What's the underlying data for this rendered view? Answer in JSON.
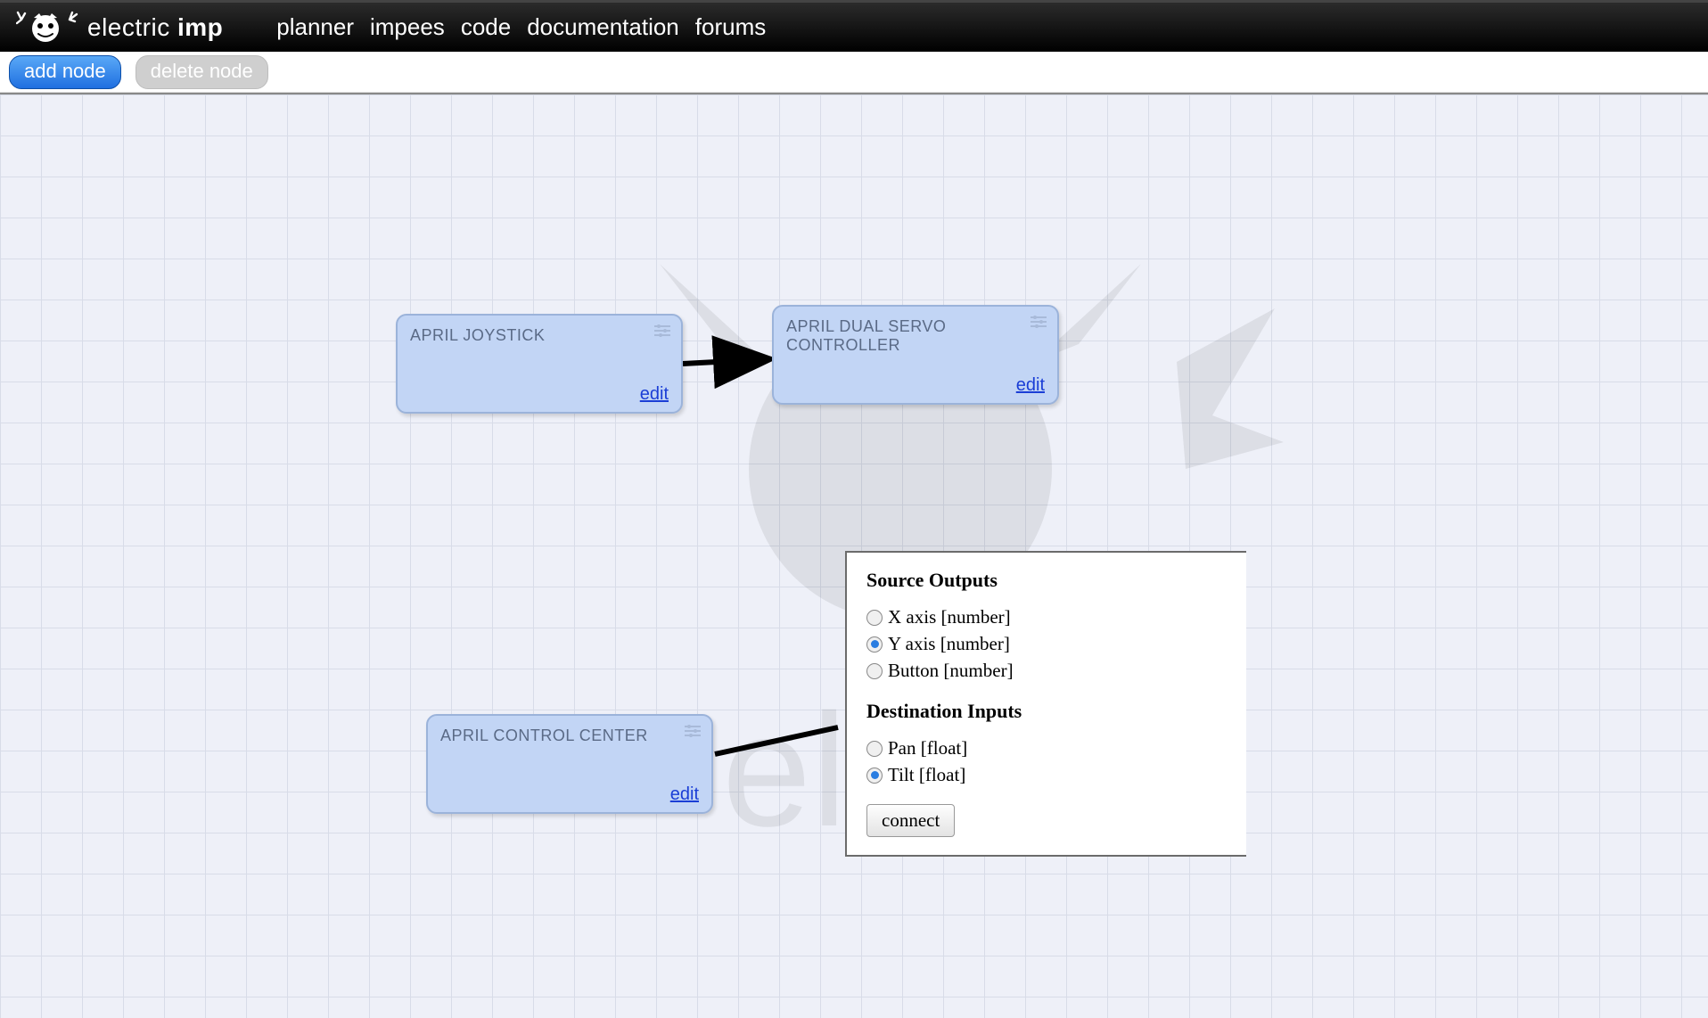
{
  "brand": {
    "name_light": "electric ",
    "name_bold": "imp"
  },
  "nav": {
    "planner": "planner",
    "impees": "impees",
    "code": "code",
    "documentation": "documentation",
    "forums": "forums"
  },
  "toolbar": {
    "add_node": "add node",
    "delete_node": "delete node"
  },
  "nodes": {
    "joystick": {
      "title": "APRIL JOYSTICK",
      "edit": "edit"
    },
    "servo": {
      "title": "APRIL DUAL SERVO CONTROLLER",
      "edit": "edit"
    },
    "control": {
      "title": "APRIL CONTROL CENTER",
      "edit": "edit"
    }
  },
  "panel": {
    "source_heading": "Source Outputs",
    "dest_heading": "Destination Inputs",
    "sources": {
      "x": "X axis [number]",
      "y": "Y axis [number]",
      "button": "Button [number]"
    },
    "dests": {
      "pan": "Pan [float]",
      "tilt": "Tilt [float]"
    },
    "connect": "connect",
    "selected_source": "y",
    "selected_dest": "tilt"
  }
}
